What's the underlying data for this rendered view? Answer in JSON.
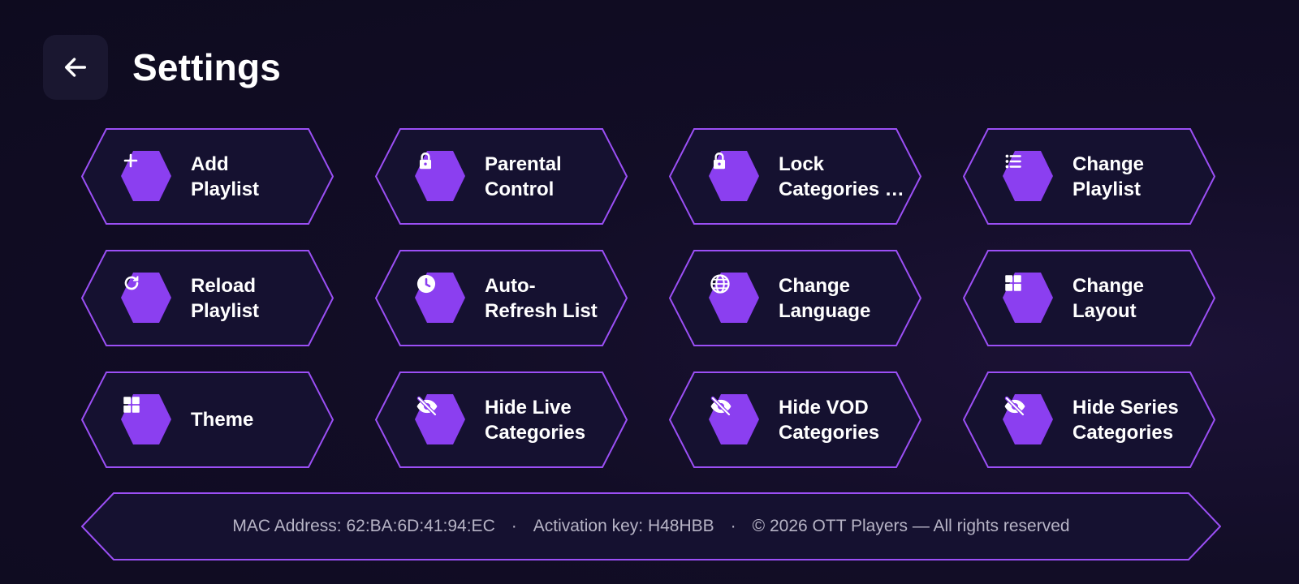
{
  "header": {
    "title": "Settings",
    "back_icon": "arrow-left-icon"
  },
  "colors": {
    "accent": "#8b3ff0",
    "border": "#9b4ff5",
    "tile_fill": "#151130"
  },
  "tiles": [
    {
      "label": "Add\nPlaylist",
      "icon": "plus-icon"
    },
    {
      "label": "Parental\nControl",
      "icon": "lock-icon"
    },
    {
      "label": "Lock\nCategories …",
      "icon": "lock-icon"
    },
    {
      "label": "Change\nPlaylist",
      "icon": "list-icon"
    },
    {
      "label": "Reload\nPlaylist",
      "icon": "refresh-icon"
    },
    {
      "label": "Auto-\nRefresh List",
      "icon": "clock-icon"
    },
    {
      "label": "Change\nLanguage",
      "icon": "globe-icon"
    },
    {
      "label": "Change\nLayout",
      "icon": "grid-icon"
    },
    {
      "label": "Theme",
      "icon": "grid-icon"
    },
    {
      "label": "Hide Live\nCategories",
      "icon": "eye-off-icon"
    },
    {
      "label": "Hide VOD\nCategories",
      "icon": "eye-off-icon"
    },
    {
      "label": "Hide Series\nCategories",
      "icon": "eye-off-icon"
    }
  ],
  "footer": {
    "mac": "MAC Address: 62:BA:6D:41:94:EC",
    "separator": "·",
    "activation": "Activation key: H48HBB",
    "copyright": "© 2026 OTT Players — All rights reserved"
  }
}
